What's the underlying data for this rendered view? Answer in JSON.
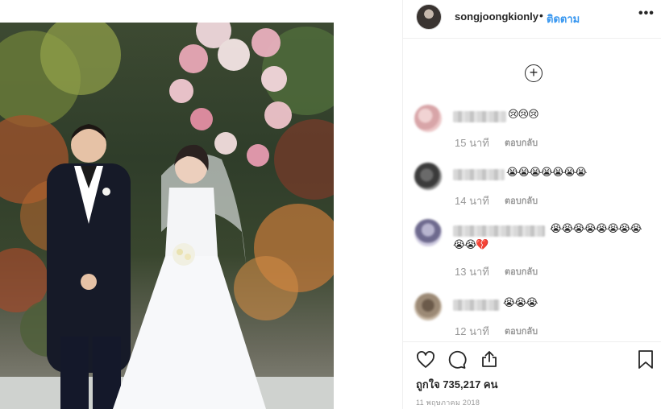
{
  "header": {
    "username": "songjoongkionly",
    "separator": "•",
    "follow_label": "ติดตาม",
    "more_label": "•••"
  },
  "load_more_label": "+",
  "comments": [
    {
      "emoji_line1": "😢😢😢",
      "emoji_line2": "",
      "time": "15 นาที",
      "reply_label": "ตอบกลับ"
    },
    {
      "emoji_line1": "😭😭😭😭😭😭😭",
      "emoji_line2": "",
      "time": "14 นาที",
      "reply_label": "ตอบกลับ"
    },
    {
      "emoji_line1": "😭😭😭😭😭😭😭😭",
      "emoji_line2": "😭😭💔",
      "time": "13 นาที",
      "reply_label": "ตอบกลับ"
    },
    {
      "emoji_line1": "😭😭😭",
      "emoji_line2": "",
      "time": "12 นาที",
      "reply_label": "ตอบกลับ"
    }
  ],
  "actions": {
    "like_icon": "heart-icon",
    "comment_icon": "comment-bubble-icon",
    "share_icon": "share-icon",
    "save_icon": "bookmark-icon"
  },
  "likes_text": "ถูกใจ 735,217 คน",
  "date_text": "11 พฤษภาคม 2018",
  "colors": {
    "accent": "#3897f0",
    "text": "#262626",
    "muted": "#999999",
    "border": "#efefef"
  }
}
